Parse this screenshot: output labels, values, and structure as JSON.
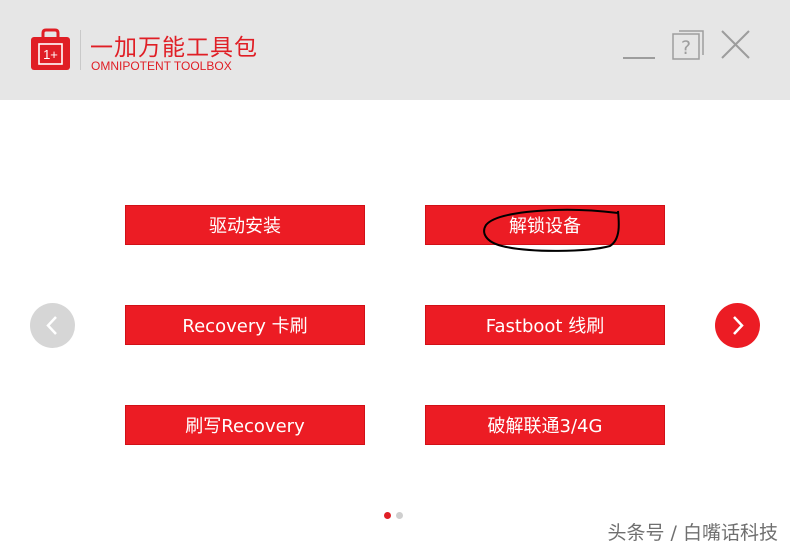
{
  "header": {
    "title": "一加万能工具包",
    "subtitle": "OMNIPOTENT TOOLBOX",
    "logo_icon": "toolbox-icon",
    "logo_text": "1+",
    "controls": {
      "minimize_icon": "minimize-icon",
      "help_icon": "help-icon",
      "close_icon": "close-icon"
    }
  },
  "main": {
    "buttons": [
      {
        "label": "驱动安装"
      },
      {
        "label": "解锁设备"
      },
      {
        "label": "Recovery 卡刷"
      },
      {
        "label": "Fastboot 线刷"
      },
      {
        "label": "刷写Recovery"
      },
      {
        "label": "破解联通3/4G"
      }
    ],
    "prev_icon": "chevron-left-icon",
    "next_icon": "chevron-right-icon",
    "page_count": 2,
    "current_page": 1
  },
  "watermark": "头条号 / 白嘴话科技",
  "colors": {
    "accent": "#ec1c24",
    "title_bar": "#e6e6e6",
    "disabled_arrow": "#d6d6d6"
  }
}
